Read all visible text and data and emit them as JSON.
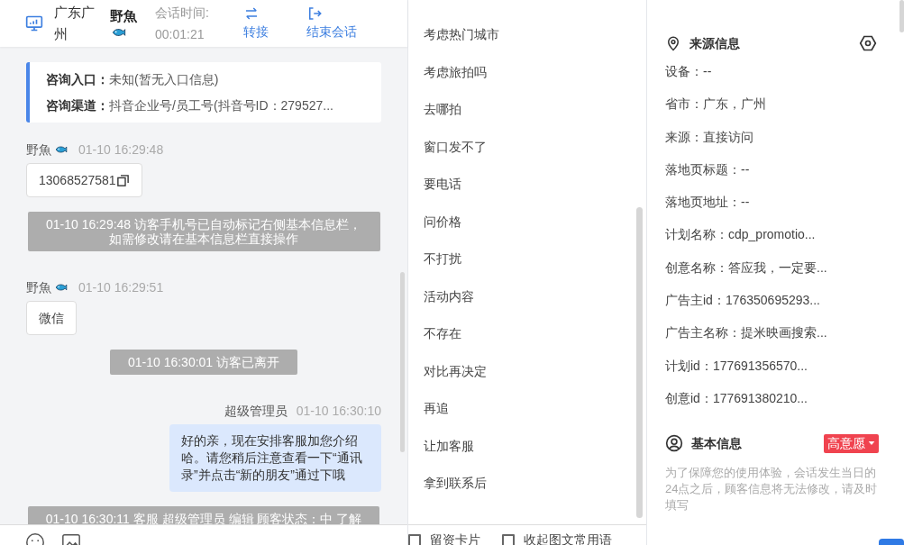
{
  "header": {
    "location": "广东广州",
    "visitor_name": "野魚",
    "session_label": "会话时间:",
    "session_time": "00:01:21",
    "actions": [
      {
        "kind": "transfer",
        "label": "转接"
      },
      {
        "kind": "end",
        "label": "结束会话"
      }
    ]
  },
  "info_card": [
    {
      "label": "咨询入口：",
      "value": "未知(暂无入口信息)"
    },
    {
      "label": "咨询渠道：",
      "value": "抖音企业号/员工号(抖音号ID：279527..."
    }
  ],
  "messages": [
    {
      "kind": "visitor",
      "sender": "野魚",
      "time": "01-10 16:29:48",
      "text": "13068527581",
      "copyable": true
    },
    {
      "kind": "system",
      "text": "01-10 16:29:48 访客手机号已自动标记右侧基本信息栏，如需修改请在基本信息栏直接操作"
    },
    {
      "kind": "visitor",
      "sender": "野魚",
      "time": "01-10 16:29:51",
      "text": "微信",
      "copyable": false
    },
    {
      "kind": "system",
      "text": "01-10 16:30:01 访客已离开"
    },
    {
      "kind": "agent",
      "sender": "超级管理员",
      "time": "01-10 16:30:10",
      "text": "好的亲，现在安排客服加您介绍哈。请您稍后注意查看一下“通讯录”并点击“新的朋友”通过下哦"
    },
    {
      "kind": "system",
      "text": "01-10 16:30:11 客服 超级管理员 编辑 顾客状态：中 了解"
    }
  ],
  "quick_replies": [
    "考虑热门城市",
    "考虑旅拍吗",
    "去哪拍",
    "窗口发不了",
    "要电话",
    "问价格",
    "不打扰",
    "活动内容",
    "不存在",
    "对比再决定",
    "再追",
    "让加客服",
    "拿到联系后"
  ],
  "bottom_options": [
    {
      "label": "留资卡片",
      "checked": false
    },
    {
      "label": "收起图文常用语",
      "checked": false
    }
  ],
  "source_info": {
    "title": "来源信息",
    "fields": [
      "设备：--",
      "省市：广东，广州",
      "来源：直接访问",
      "落地页标题：--",
      "落地页地址：--",
      "计划名称：cdp_promotio...",
      "创意名称：答应我，一定要...",
      "广告主id：176350695293...",
      "广告主名称：提米映画搜索...",
      "计划id：177691356570...",
      "创意id：177691380210..."
    ]
  },
  "basic_info": {
    "title": "基本信息",
    "intent": "高意愿",
    "note": "为了保障您的使用体验，会话发生当日的24点之后，顾客信息将无法修改，请及时填写"
  }
}
